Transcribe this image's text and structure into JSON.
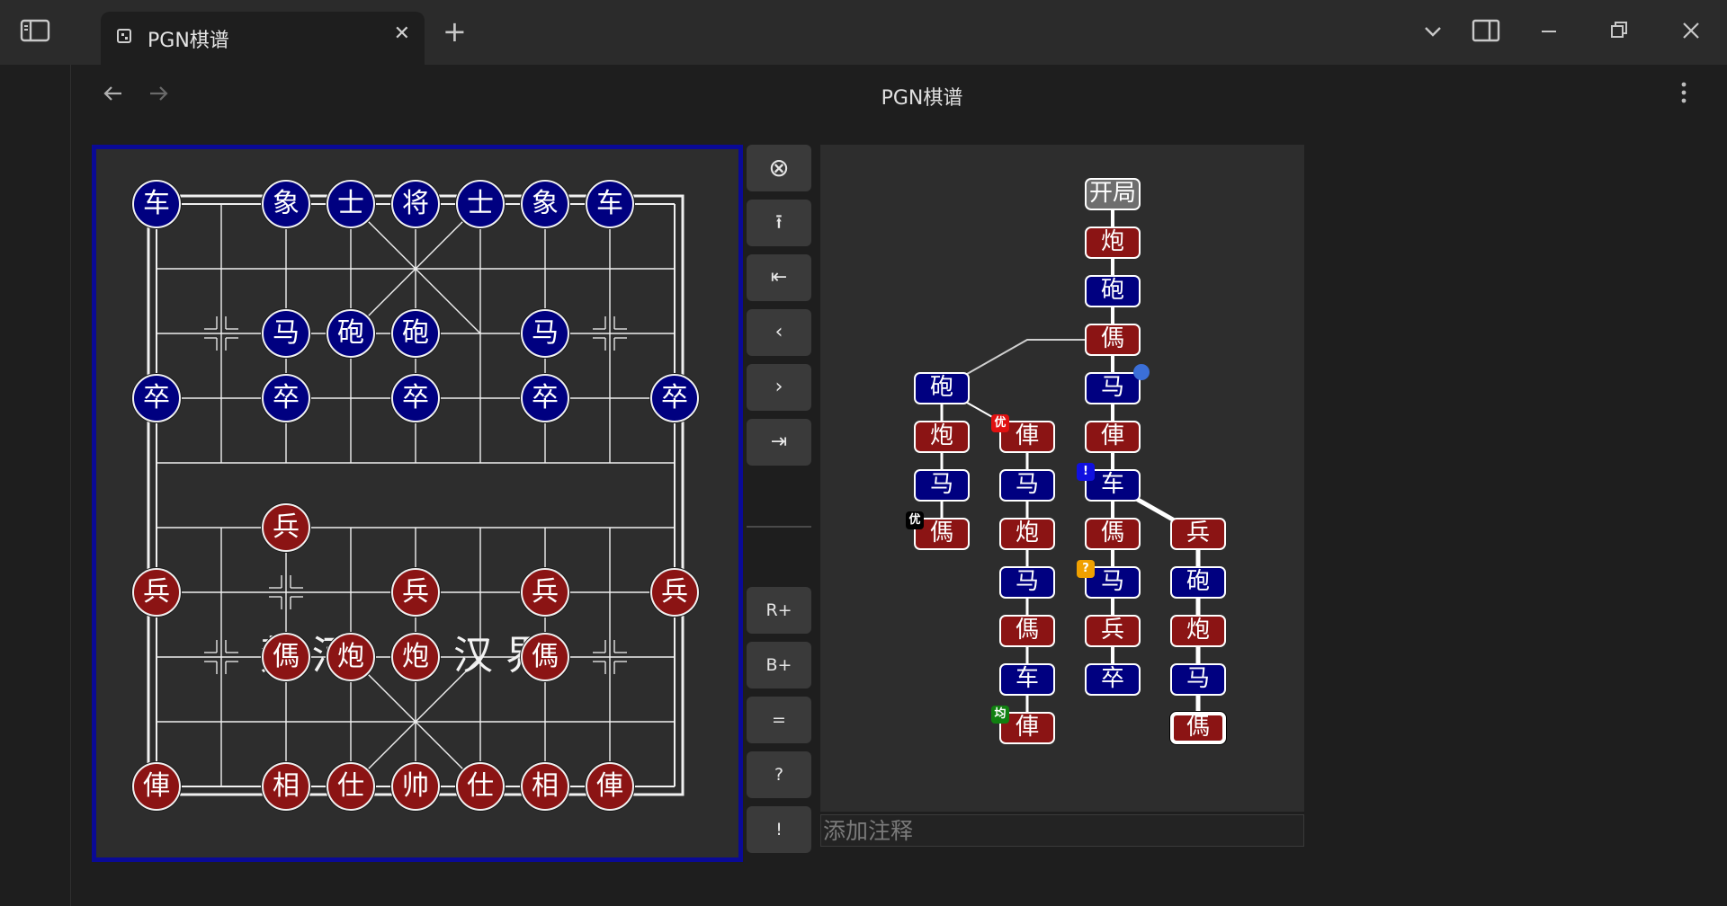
{
  "window": {
    "tab_title": "PGN棋谱",
    "page_title": "PGN棋谱",
    "new_tab_symbol": "+",
    "close_symbol": "✕"
  },
  "board": {
    "river_left": "楚 河",
    "river_right": "汉 界",
    "pieces": [
      {
        "side": "black",
        "label": "车",
        "col": 0,
        "row": 0
      },
      {
        "side": "black",
        "label": "象",
        "col": 2,
        "row": 0
      },
      {
        "side": "black",
        "label": "士",
        "col": 3,
        "row": 0
      },
      {
        "side": "black",
        "label": "将",
        "col": 4,
        "row": 0
      },
      {
        "side": "black",
        "label": "士",
        "col": 5,
        "row": 0
      },
      {
        "side": "black",
        "label": "象",
        "col": 6,
        "row": 0
      },
      {
        "side": "black",
        "label": "车",
        "col": 7,
        "row": 0
      },
      {
        "side": "black",
        "label": "马",
        "col": 2,
        "row": 2
      },
      {
        "side": "black",
        "label": "砲",
        "col": 3,
        "row": 2
      },
      {
        "side": "black",
        "label": "砲",
        "col": 4,
        "row": 2
      },
      {
        "side": "black",
        "label": "马",
        "col": 6,
        "row": 2
      },
      {
        "side": "black",
        "label": "卒",
        "col": 0,
        "row": 3
      },
      {
        "side": "black",
        "label": "卒",
        "col": 2,
        "row": 3
      },
      {
        "side": "black",
        "label": "卒",
        "col": 4,
        "row": 3
      },
      {
        "side": "black",
        "label": "卒",
        "col": 6,
        "row": 3
      },
      {
        "side": "black",
        "label": "卒",
        "col": 8,
        "row": 3
      },
      {
        "side": "red",
        "label": "兵",
        "col": 2,
        "row": 5
      },
      {
        "side": "red",
        "label": "兵",
        "col": 0,
        "row": 6
      },
      {
        "side": "red",
        "label": "兵",
        "col": 4,
        "row": 6
      },
      {
        "side": "red",
        "label": "兵",
        "col": 6,
        "row": 6
      },
      {
        "side": "red",
        "label": "兵",
        "col": 8,
        "row": 6
      },
      {
        "side": "red",
        "label": "傌",
        "col": 2,
        "row": 7
      },
      {
        "side": "red",
        "label": "炮",
        "col": 3,
        "row": 7
      },
      {
        "side": "red",
        "label": "炮",
        "col": 4,
        "row": 7
      },
      {
        "side": "red",
        "label": "傌",
        "col": 6,
        "row": 7
      },
      {
        "side": "red",
        "label": "俥",
        "col": 0,
        "row": 9
      },
      {
        "side": "red",
        "label": "相",
        "col": 2,
        "row": 9
      },
      {
        "side": "red",
        "label": "仕",
        "col": 3,
        "row": 9
      },
      {
        "side": "red",
        "label": "帅",
        "col": 4,
        "row": 9
      },
      {
        "side": "red",
        "label": "仕",
        "col": 5,
        "row": 9
      },
      {
        "side": "red",
        "label": "相",
        "col": 6,
        "row": 9
      },
      {
        "side": "red",
        "label": "俥",
        "col": 7,
        "row": 9
      }
    ]
  },
  "controls": {
    "buttons": [
      {
        "name": "clear-button",
        "symbol": "⊗"
      },
      {
        "name": "promote-variation-button",
        "symbol": "⭱"
      },
      {
        "name": "first-move-button",
        "symbol": "⇤"
      },
      {
        "name": "prev-move-button",
        "symbol": "‹"
      },
      {
        "name": "next-move-button",
        "symbol": "›"
      },
      {
        "name": "last-move-button",
        "symbol": "⇥"
      }
    ],
    "annotation_buttons": [
      {
        "name": "red-advantage-button",
        "label": "R+"
      },
      {
        "name": "black-advantage-button",
        "label": "B+"
      },
      {
        "name": "equal-button",
        "label": "="
      },
      {
        "name": "dubious-button",
        "label": "?"
      },
      {
        "name": "good-move-button",
        "label": "!"
      }
    ]
  },
  "tree": {
    "start_label": "开局",
    "nodes": [
      {
        "id": "m1",
        "side": "red",
        "label": "炮",
        "col": 0,
        "row": 1
      },
      {
        "id": "m2",
        "side": "black",
        "label": "砲",
        "col": 0,
        "row": 2
      },
      {
        "id": "m3",
        "side": "red",
        "label": "傌",
        "col": 0,
        "row": 3
      },
      {
        "id": "m4",
        "side": "black",
        "label": "马",
        "col": 0,
        "row": 4
      },
      {
        "id": "m5",
        "side": "red",
        "label": "俥",
        "col": 0,
        "row": 5
      },
      {
        "id": "m6",
        "side": "black",
        "label": "车",
        "col": 0,
        "row": 6
      },
      {
        "id": "m7",
        "side": "red",
        "label": "傌",
        "col": 0,
        "row": 7
      },
      {
        "id": "m8",
        "side": "black",
        "label": "马",
        "col": 0,
        "row": 8
      },
      {
        "id": "m9",
        "side": "red",
        "label": "兵",
        "col": 0,
        "row": 9
      },
      {
        "id": "m10",
        "side": "black",
        "label": "卒",
        "col": 0,
        "row": 10
      },
      {
        "id": "a4",
        "side": "black",
        "label": "砲",
        "col": -2,
        "row": 4
      },
      {
        "id": "a5",
        "side": "red",
        "label": "炮",
        "col": -2,
        "row": 5
      },
      {
        "id": "a6",
        "side": "black",
        "label": "马",
        "col": -2,
        "row": 6
      },
      {
        "id": "a7",
        "side": "red",
        "label": "傌",
        "col": -2,
        "row": 7
      },
      {
        "id": "b5",
        "side": "red",
        "label": "俥",
        "col": -1,
        "row": 5
      },
      {
        "id": "b6",
        "side": "black",
        "label": "马",
        "col": -1,
        "row": 6
      },
      {
        "id": "b7",
        "side": "red",
        "label": "炮",
        "col": -1,
        "row": 7
      },
      {
        "id": "b8",
        "side": "black",
        "label": "马",
        "col": -1,
        "row": 8
      },
      {
        "id": "b9",
        "side": "red",
        "label": "傌",
        "col": -1,
        "row": 9
      },
      {
        "id": "b10",
        "side": "black",
        "label": "车",
        "col": -1,
        "row": 10
      },
      {
        "id": "b11",
        "side": "red",
        "label": "俥",
        "col": -1,
        "row": 11
      },
      {
        "id": "c7",
        "side": "red",
        "label": "兵",
        "col": 1,
        "row": 7
      },
      {
        "id": "c8",
        "side": "black",
        "label": "砲",
        "col": 1,
        "row": 8
      },
      {
        "id": "c9",
        "side": "red",
        "label": "炮",
        "col": 1,
        "row": 9
      },
      {
        "id": "c10",
        "side": "black",
        "label": "马",
        "col": 1,
        "row": 10
      },
      {
        "id": "c11",
        "side": "red",
        "label": "傌",
        "col": 1,
        "row": 11,
        "current": true
      }
    ],
    "badges": [
      {
        "text": "优",
        "color": "#e01010",
        "node": "b5"
      },
      {
        "text": "优",
        "color": "#000000",
        "node": "a7"
      },
      {
        "text": "!",
        "color": "#1010e0",
        "node": "m6"
      },
      {
        "text": "?",
        "color": "#f0a000",
        "node": "m8"
      },
      {
        "text": "均",
        "color": "#108010",
        "node": "b11"
      }
    ],
    "blue_dot_node": "m4"
  },
  "comment": {
    "placeholder": "添加注释"
  }
}
